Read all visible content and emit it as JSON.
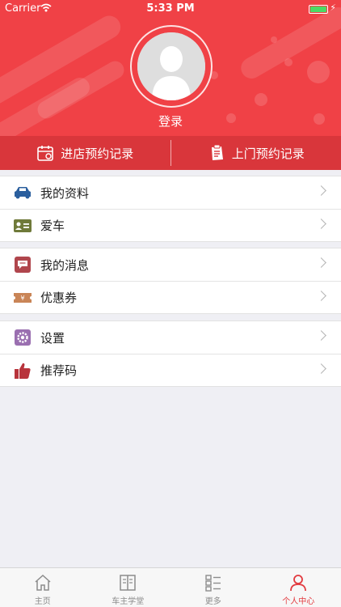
{
  "status_bar": {
    "carrier": "Carrier",
    "time": "5:33 PM"
  },
  "profile": {
    "login_label": "登录"
  },
  "records": [
    {
      "label": "进店预约记录",
      "icon": "calendar-icon"
    },
    {
      "label": "上门预约记录",
      "icon": "clipboard-icon"
    }
  ],
  "menu": {
    "group1": [
      {
        "label": "我的资料",
        "icon": "car-icon",
        "color": "#2b5f9e"
      },
      {
        "label": "爱车",
        "icon": "id-card-icon",
        "color": "#6f7a3a"
      }
    ],
    "group2": [
      {
        "label": "我的消息",
        "icon": "message-icon",
        "color": "#b0464d"
      },
      {
        "label": "优惠券",
        "icon": "coupon-icon",
        "color": "#c98557"
      }
    ],
    "group3": [
      {
        "label": "设置",
        "icon": "gear-icon",
        "color": "#9a6fb0"
      },
      {
        "label": "推荐码",
        "icon": "thumbs-up-icon",
        "color": "#b8343c"
      }
    ]
  },
  "tabs": [
    {
      "label": "主页",
      "icon": "home-icon",
      "active": false
    },
    {
      "label": "车主学堂",
      "icon": "book-icon",
      "active": false
    },
    {
      "label": "更多",
      "icon": "list-icon",
      "active": false
    },
    {
      "label": "个人中心",
      "icon": "person-icon",
      "active": true
    }
  ],
  "colors": {
    "header": "#f04146",
    "records_bar": "#d9363b",
    "active_tab": "#e23a3f"
  }
}
